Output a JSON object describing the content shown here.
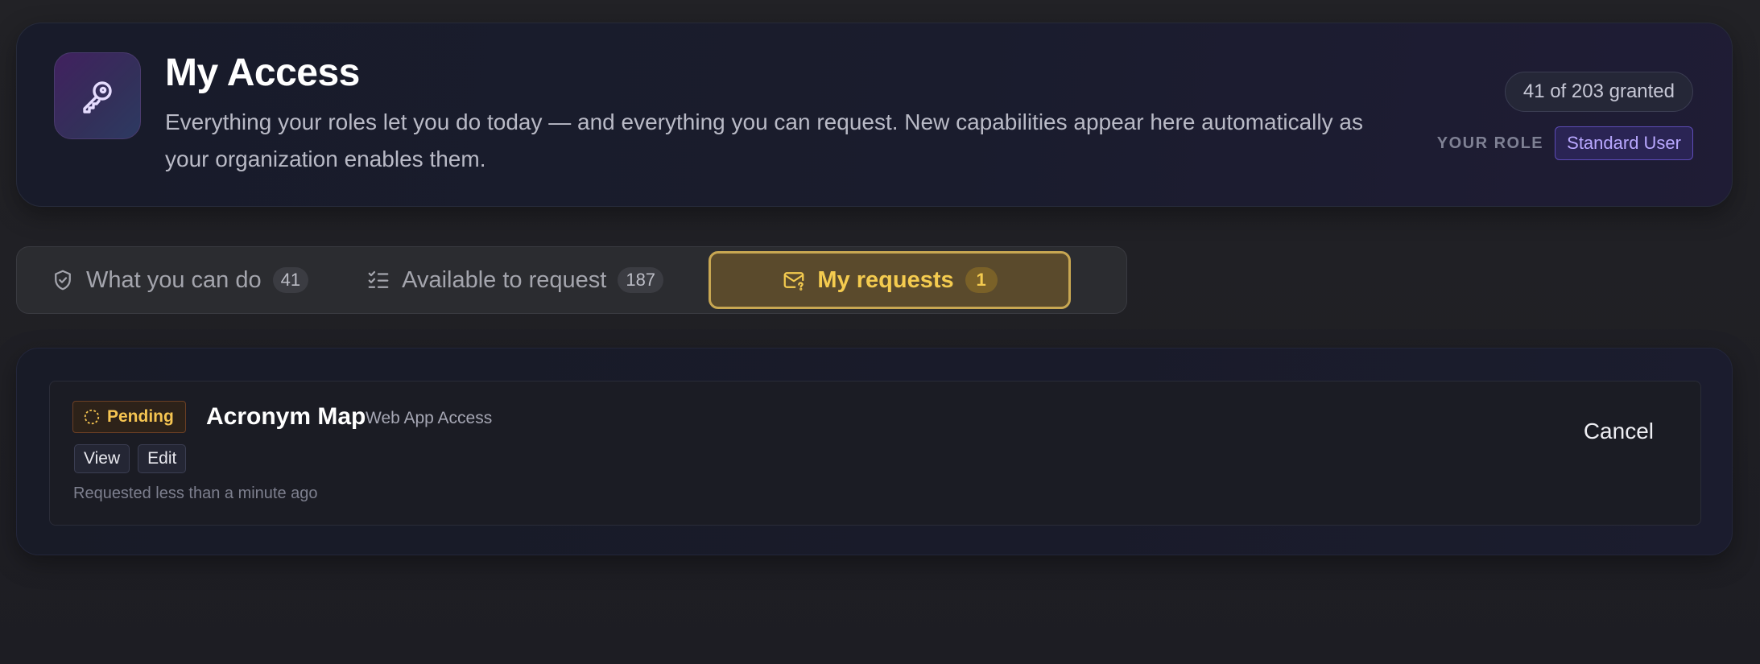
{
  "header": {
    "title": "My Access",
    "subtitle": "Everything your roles let you do today — and everything you can request. New capabilities appear here automatically as your organization enables them.",
    "granted_summary": "41 of 203 granted",
    "role_label": "YOUR ROLE",
    "role_value": "Standard User",
    "icon": "key-icon"
  },
  "tabs": [
    {
      "label": "What you can do",
      "count": "41",
      "icon": "shield-check-icon",
      "active": false
    },
    {
      "label": "Available to request",
      "count": "187",
      "icon": "checklist-icon",
      "active": false
    },
    {
      "label": "My requests",
      "count": "1",
      "icon": "mail-question-icon",
      "active": true
    }
  ],
  "requests": [
    {
      "status": "Pending",
      "status_icon": "pending-dashed-circle-icon",
      "title": "Acronym Map",
      "type": "Web App Access",
      "permissions": [
        "View",
        "Edit"
      ],
      "requested": "Requested less than a minute ago",
      "cancel_label": "Cancel"
    }
  ],
  "colors": {
    "accent_active_tab": "#f4cb4f",
    "role_badge": "#b9a8ff",
    "pending": "#f5c451"
  }
}
